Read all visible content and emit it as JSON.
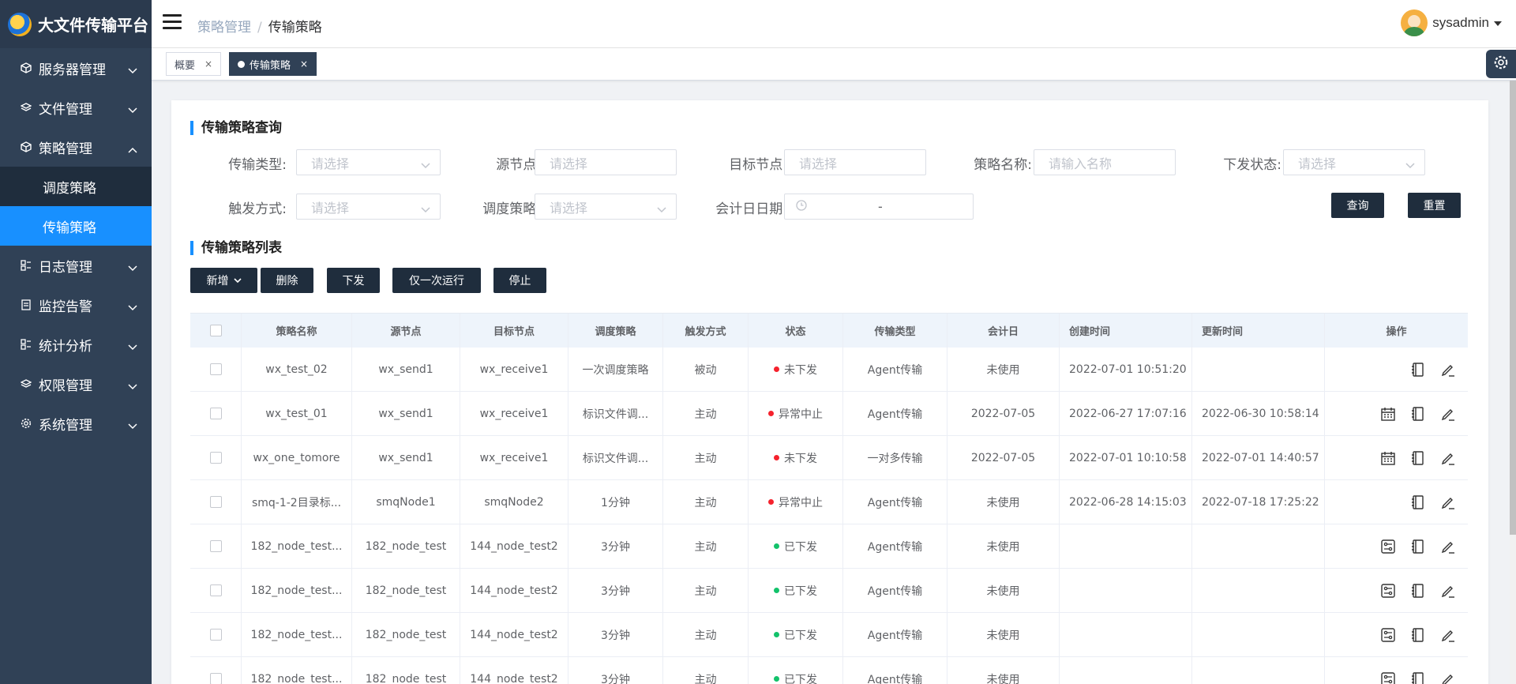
{
  "app": {
    "title": "大文件传输平台"
  },
  "sidebar": {
    "items": [
      {
        "label": "服务器管理"
      },
      {
        "label": "文件管理"
      },
      {
        "label": "策略管理",
        "expanded": true,
        "children": [
          {
            "label": "调度策略"
          },
          {
            "label": "传输策略",
            "active": true
          }
        ]
      },
      {
        "label": "日志管理"
      },
      {
        "label": "监控告警"
      },
      {
        "label": "统计分析"
      },
      {
        "label": "权限管理"
      },
      {
        "label": "系统管理"
      }
    ]
  },
  "header": {
    "breadcrumb": [
      "策略管理",
      "传输策略"
    ],
    "user": "sysadmin"
  },
  "tags": [
    {
      "label": "概要"
    },
    {
      "label": "传输策略",
      "active": true
    }
  ],
  "query": {
    "title": "传输策略查询",
    "fields": {
      "transfer_type": {
        "label": "传输类型:",
        "placeholder": "请选择"
      },
      "source_node": {
        "label": "源节点:",
        "placeholder": "请选择"
      },
      "target_node": {
        "label": "目标节点:",
        "placeholder": "请选择"
      },
      "policy_name": {
        "label": "策略名称:",
        "placeholder": "请输入名称"
      },
      "dispatch_status": {
        "label": "下发状态:",
        "placeholder": "请选择"
      },
      "trigger_mode": {
        "label": "触发方式:",
        "placeholder": "请选择"
      },
      "schedule_policy": {
        "label": "调度策略:",
        "placeholder": "请选择"
      },
      "accounting_date": {
        "label": "会计日日期:",
        "separator": "-"
      }
    },
    "search_label": "查询",
    "reset_label": "重置"
  },
  "list": {
    "title": "传输策略列表",
    "toolbar": {
      "add": "新增",
      "delete": "删除",
      "dispatch": "下发",
      "run_once": "仅一次运行",
      "stop": "停止"
    },
    "columns": [
      "策略名称",
      "源节点",
      "目标节点",
      "调度策略",
      "触发方式",
      "状态",
      "传输类型",
      "会计日",
      "创建时间",
      "更新时间",
      "操作"
    ],
    "rows": [
      {
        "name": "wx_test_02",
        "source": "wx_send1",
        "target": "wx_receive1",
        "schedule": "一次调度策略",
        "trigger": "被动",
        "status": "未下发",
        "status_color": "#f5222d",
        "type": "Agent传输",
        "acc_date": "未使用",
        "created": "2022-07-01 10:51:20",
        "updated": "",
        "ops": [
          "log"
        ]
      },
      {
        "name": "wx_test_01",
        "source": "wx_send1",
        "target": "wx_receive1",
        "schedule": "标识文件调...",
        "trigger": "主动",
        "status": "异常中止",
        "status_color": "#f5222d",
        "type": "Agent传输",
        "acc_date": "2022-07-05",
        "created": "2022-06-27 17:07:16",
        "updated": "2022-06-30 10:58:14",
        "ops": [
          "calendar",
          "log"
        ]
      },
      {
        "name": "wx_one_tomore",
        "source": "wx_send1",
        "target": "wx_receive1",
        "schedule": "标识文件调...",
        "trigger": "主动",
        "status": "未下发",
        "status_color": "#f5222d",
        "type": "一对多传输",
        "acc_date": "2022-07-05",
        "created": "2022-07-01 10:10:58",
        "updated": "2022-07-01 14:40:57",
        "ops": [
          "calendar",
          "log"
        ]
      },
      {
        "name": "smq-1-2目录标...",
        "source": "smqNode1",
        "target": "smqNode2",
        "schedule": "1分钟",
        "trigger": "主动",
        "status": "异常中止",
        "status_color": "#f5222d",
        "type": "Agent传输",
        "acc_date": "未使用",
        "created": "2022-06-28 14:15:03",
        "updated": "2022-07-18 17:25:22",
        "ops": [
          "log"
        ]
      },
      {
        "name": "182_node_test...",
        "source": "182_node_test",
        "target": "144_node_test2",
        "schedule": "3分钟",
        "trigger": "主动",
        "status": "已下发",
        "status_color": "#13c26b",
        "type": "Agent传输",
        "acc_date": "未使用",
        "created": "",
        "updated": "",
        "ops": [
          "monitor",
          "log"
        ]
      },
      {
        "name": "182_node_test...",
        "source": "182_node_test",
        "target": "144_node_test2",
        "schedule": "3分钟",
        "trigger": "主动",
        "status": "已下发",
        "status_color": "#13c26b",
        "type": "Agent传输",
        "acc_date": "未使用",
        "created": "",
        "updated": "",
        "ops": [
          "monitor",
          "log"
        ]
      },
      {
        "name": "182_node_test...",
        "source": "182_node_test",
        "target": "144_node_test2",
        "schedule": "3分钟",
        "trigger": "主动",
        "status": "已下发",
        "status_color": "#13c26b",
        "type": "Agent传输",
        "acc_date": "未使用",
        "created": "",
        "updated": "",
        "ops": [
          "monitor",
          "log"
        ]
      },
      {
        "name": "182_node_test...",
        "source": "182_node_test",
        "target": "144_node_test2",
        "schedule": "3分钟",
        "trigger": "主动",
        "status": "已下发",
        "status_color": "#13c26b",
        "type": "Agent传输",
        "acc_date": "未使用",
        "created": "",
        "updated": "",
        "ops": [
          "monitor",
          "log"
        ]
      }
    ]
  }
}
